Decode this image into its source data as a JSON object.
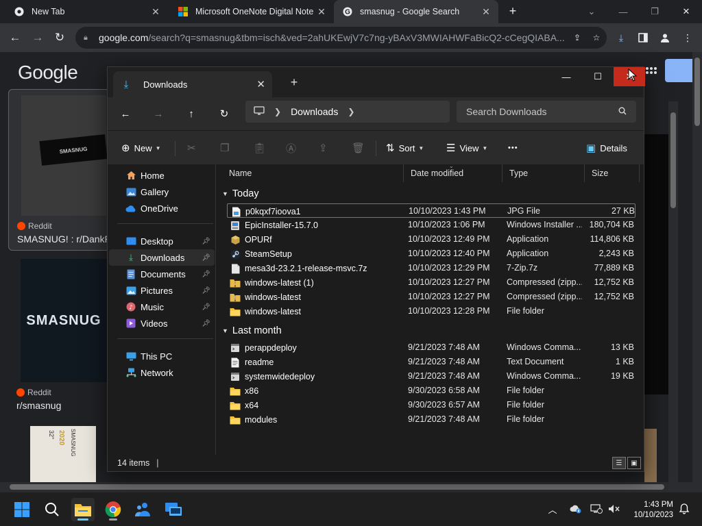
{
  "browser": {
    "tabs": [
      {
        "label": "New Tab",
        "close": "✕"
      },
      {
        "label": "Microsoft OneNote Digital Note",
        "close": "✕"
      },
      {
        "label": "smasnug - Google Search",
        "close": "✕"
      }
    ],
    "new_tab": "+",
    "url_host": "google.com",
    "url_path": "/search?q=smasnug&tbm=isch&ved=2ahUKEwjV7c7ng-yBAxV3MWIAHWFaBicQ2-cCegQIABA..."
  },
  "google": {
    "logo": "Google",
    "results": [
      {
        "source": "Reddit",
        "title": "SMASNUG! : r/DankP",
        "thumb_text": "SMASNUG"
      },
      {
        "source": "Reddit",
        "title": "r/smasnug",
        "thumb_text": "SMASNUG"
      }
    ],
    "box_text": [
      "SMASNUG",
      "2020",
      "32\""
    ]
  },
  "explorer": {
    "tab_label": "Downloads",
    "tab_close": "✕",
    "new_tab": "+",
    "breadcrumb": {
      "location": "Downloads"
    },
    "search_placeholder": "Search Downloads",
    "commands": {
      "new": "New",
      "sort": "Sort",
      "view": "View",
      "more": "•••",
      "details": "Details"
    },
    "nav": {
      "home": "Home",
      "gallery": "Gallery",
      "onedrive": "OneDrive",
      "desktop": "Desktop",
      "downloads": "Downloads",
      "documents": "Documents",
      "pictures": "Pictures",
      "music": "Music",
      "videos": "Videos",
      "thispc": "This PC",
      "network": "Network"
    },
    "columns": {
      "name": "Name",
      "date": "Date modified",
      "type": "Type",
      "size": "Size"
    },
    "groups": {
      "today": "Today",
      "lastmonth": "Last month"
    },
    "files_today": [
      {
        "name": "p0kqxf7ioova1",
        "date": "10/10/2023 1:43 PM",
        "type": "JPG File",
        "size": "27 KB",
        "icon": "image-file"
      },
      {
        "name": "EpicInstaller-15.7.0",
        "date": "10/10/2023 1:06 PM",
        "type": "Windows Installer ...",
        "size": "180,704 KB",
        "icon": "installer"
      },
      {
        "name": "OPURf",
        "date": "10/10/2023 12:49 PM",
        "type": "Application",
        "size": "114,806 KB",
        "icon": "application"
      },
      {
        "name": "SteamSetup",
        "date": "10/10/2023 12:40 PM",
        "type": "Application",
        "size": "2,243 KB",
        "icon": "steam"
      },
      {
        "name": "mesa3d-23.2.1-release-msvc.7z",
        "date": "10/10/2023 12:29 PM",
        "type": "7-Zip.7z",
        "size": "77,889 KB",
        "icon": "file"
      },
      {
        "name": "windows-latest (1)",
        "date": "10/10/2023 12:27 PM",
        "type": "Compressed (zipp...",
        "size": "12,752 KB",
        "icon": "zip-folder"
      },
      {
        "name": "windows-latest",
        "date": "10/10/2023 12:27 PM",
        "type": "Compressed (zipp...",
        "size": "12,752 KB",
        "icon": "zip-folder"
      },
      {
        "name": "windows-latest",
        "date": "10/10/2023 12:28 PM",
        "type": "File folder",
        "size": "",
        "icon": "folder"
      }
    ],
    "files_lastmonth": [
      {
        "name": "perappdeploy",
        "date": "9/21/2023 7:48 AM",
        "type": "Windows Comma...",
        "size": "13 KB",
        "icon": "script"
      },
      {
        "name": "readme",
        "date": "9/21/2023 7:48 AM",
        "type": "Text Document",
        "size": "1 KB",
        "icon": "text-file"
      },
      {
        "name": "systemwidedeploy",
        "date": "9/21/2023 7:48 AM",
        "type": "Windows Comma...",
        "size": "19 KB",
        "icon": "script"
      },
      {
        "name": "x86",
        "date": "9/30/2023 6:58 AM",
        "type": "File folder",
        "size": "",
        "icon": "folder"
      },
      {
        "name": "x64",
        "date": "9/30/2023 6:57 AM",
        "type": "File folder",
        "size": "",
        "icon": "folder"
      },
      {
        "name": "modules",
        "date": "9/21/2023 7:48 AM",
        "type": "File folder",
        "size": "",
        "icon": "folder"
      }
    ],
    "status": "14 items",
    "status_cursor": "|"
  },
  "taskbar": {
    "time": "1:43 PM",
    "date": "10/10/2023"
  },
  "colors": {
    "accent_blue": "#60cdff",
    "folder_yellow": "#f3c13a",
    "close_red": "#c42b1c",
    "reddit_orange": "#ff4500"
  }
}
